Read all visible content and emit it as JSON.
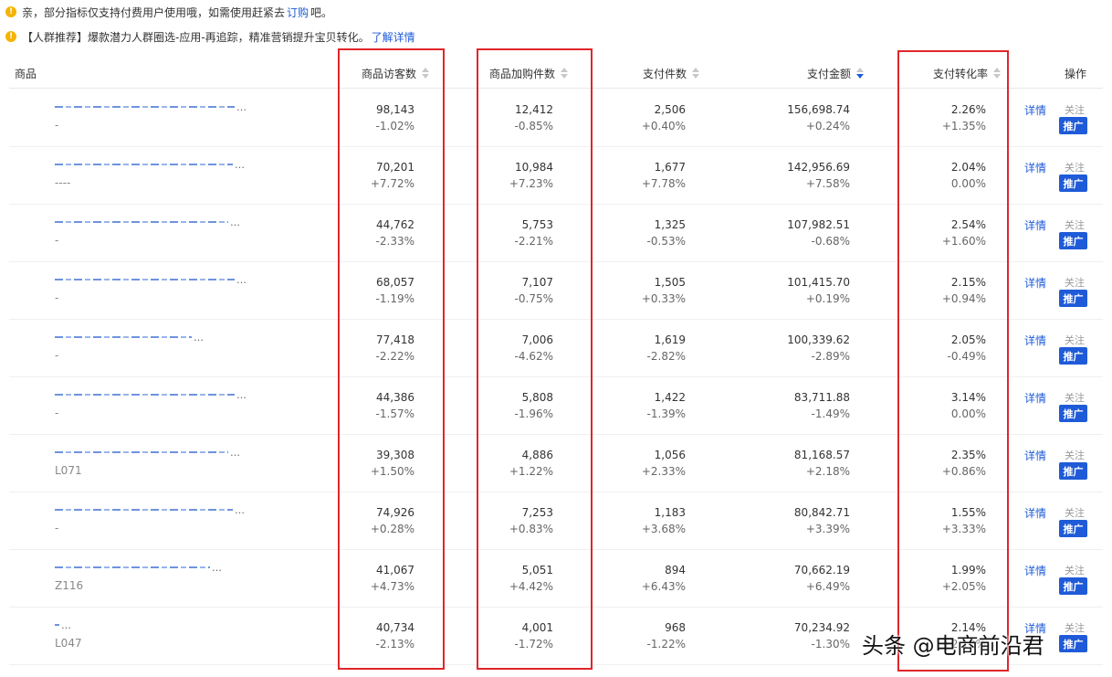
{
  "notices": [
    {
      "before": "亲，部分指标仅支持付费用户使用哦，如需使用赶紧去",
      "link": "订购",
      "after": "吧。"
    },
    {
      "before": "【人群推荐】爆款潜力人群圈选-应用-再追踪，精准营销提升宝贝转化。",
      "link": "了解详情",
      "after": ""
    }
  ],
  "columns": {
    "product": "商品",
    "visitors": "商品访客数",
    "cart": "商品加购件数",
    "paid_items": "支付件数",
    "paid_amount": "支付金额",
    "conversion": "支付转化率",
    "actions": "操作"
  },
  "actions": {
    "detail": "详情",
    "follow": "关注",
    "promote": "推广"
  },
  "rows": [
    {
      "code": "-",
      "visitors": "98,143",
      "visitors_chg": "-1.02%",
      "cart": "12,412",
      "cart_chg": "-0.85%",
      "paid_items": "2,506",
      "paid_items_chg": "+0.40%",
      "paid_amount": "156,698.74",
      "paid_amount_chg": "+0.24%",
      "conversion": "2.26%",
      "conversion_chg": "+1.35%"
    },
    {
      "code": "----",
      "visitors": "70,201",
      "visitors_chg": "+7.72%",
      "cart": "10,984",
      "cart_chg": "+7.23%",
      "paid_items": "1,677",
      "paid_items_chg": "+7.78%",
      "paid_amount": "142,956.69",
      "paid_amount_chg": "+7.58%",
      "conversion": "2.04%",
      "conversion_chg": "0.00%"
    },
    {
      "code": "-",
      "visitors": "44,762",
      "visitors_chg": "-2.33%",
      "cart": "5,753",
      "cart_chg": "-2.21%",
      "paid_items": "1,325",
      "paid_items_chg": "-0.53%",
      "paid_amount": "107,982.51",
      "paid_amount_chg": "-0.68%",
      "conversion": "2.54%",
      "conversion_chg": "+1.60%"
    },
    {
      "code": "-",
      "visitors": "68,057",
      "visitors_chg": "-1.19%",
      "cart": "7,107",
      "cart_chg": "-0.75%",
      "paid_items": "1,505",
      "paid_items_chg": "+0.33%",
      "paid_amount": "101,415.70",
      "paid_amount_chg": "+0.19%",
      "conversion": "2.15%",
      "conversion_chg": "+0.94%"
    },
    {
      "code": "-",
      "visitors": "77,418",
      "visitors_chg": "-2.22%",
      "cart": "7,006",
      "cart_chg": "-4.62%",
      "paid_items": "1,619",
      "paid_items_chg": "-2.82%",
      "paid_amount": "100,339.62",
      "paid_amount_chg": "-2.89%",
      "conversion": "2.05%",
      "conversion_chg": "-0.49%"
    },
    {
      "code": "-",
      "visitors": "44,386",
      "visitors_chg": "-1.57%",
      "cart": "5,808",
      "cart_chg": "-1.96%",
      "paid_items": "1,422",
      "paid_items_chg": "-1.39%",
      "paid_amount": "83,711.88",
      "paid_amount_chg": "-1.49%",
      "conversion": "3.14%",
      "conversion_chg": "0.00%"
    },
    {
      "code": "L071",
      "visitors": "39,308",
      "visitors_chg": "+1.50%",
      "cart": "4,886",
      "cart_chg": "+1.22%",
      "paid_items": "1,056",
      "paid_items_chg": "+2.33%",
      "paid_amount": "81,168.57",
      "paid_amount_chg": "+2.18%",
      "conversion": "2.35%",
      "conversion_chg": "+0.86%"
    },
    {
      "code": "-",
      "visitors": "74,926",
      "visitors_chg": "+0.28%",
      "cart": "7,253",
      "cart_chg": "+0.83%",
      "paid_items": "1,183",
      "paid_items_chg": "+3.68%",
      "paid_amount": "80,842.71",
      "paid_amount_chg": "+3.39%",
      "conversion": "1.55%",
      "conversion_chg": "+3.33%"
    },
    {
      "code": "Z116",
      "visitors": "41,067",
      "visitors_chg": "+4.73%",
      "cart": "5,051",
      "cart_chg": "+4.42%",
      "paid_items": "894",
      "paid_items_chg": "+6.43%",
      "paid_amount": "70,662.19",
      "paid_amount_chg": "+6.49%",
      "conversion": "1.99%",
      "conversion_chg": "+2.05%"
    },
    {
      "code": "L047",
      "visitors": "40,734",
      "visitors_chg": "-2.13%",
      "cart": "4,001",
      "cart_chg": "-1.72%",
      "paid_items": "968",
      "paid_items_chg": "-1.22%",
      "paid_amount": "70,234.92",
      "paid_amount_chg": "-1.30%",
      "conversion": "2.14%",
      "conversion_chg": "+2.12%"
    }
  ],
  "watermark": "头条 @电商前沿君",
  "colors": {
    "accent": "#1f5bd8",
    "highlight_box": "#e0262b",
    "warning": "#f5b400"
  }
}
